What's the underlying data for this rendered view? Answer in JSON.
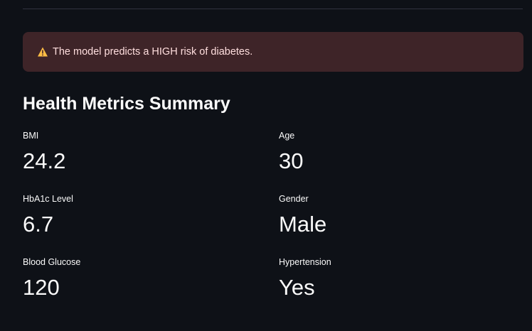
{
  "alert": {
    "message": "The model predicts a HIGH risk of diabetes.",
    "icon": "warning-icon",
    "background": "#3e2428",
    "text_color": "#ffdede",
    "icon_color": "#ffbd45"
  },
  "section": {
    "title": "Health Metrics Summary"
  },
  "metrics": [
    {
      "label": "BMI",
      "value": "24.2"
    },
    {
      "label": "Age",
      "value": "30"
    },
    {
      "label": "HbA1c Level",
      "value": "6.7"
    },
    {
      "label": "Gender",
      "value": "Male"
    },
    {
      "label": "Blood Glucose",
      "value": "120"
    },
    {
      "label": "Hypertension",
      "value": "Yes"
    }
  ]
}
